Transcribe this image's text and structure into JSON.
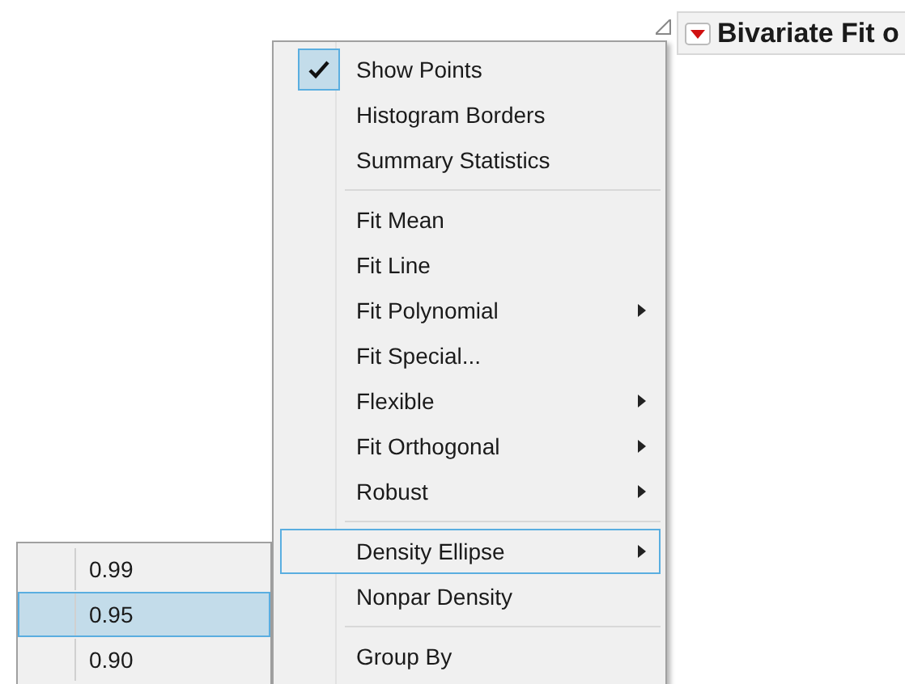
{
  "report_header": {
    "title": "Bivariate Fit o"
  },
  "menu": {
    "sections": [
      {
        "items": [
          {
            "label": "Show Points",
            "checked": true,
            "has_submenu": false,
            "selected": false
          },
          {
            "label": "Histogram Borders",
            "checked": false,
            "has_submenu": false,
            "selected": false
          },
          {
            "label": "Summary Statistics",
            "checked": false,
            "has_submenu": false,
            "selected": false
          }
        ]
      },
      {
        "items": [
          {
            "label": "Fit Mean",
            "checked": false,
            "has_submenu": false,
            "selected": false
          },
          {
            "label": "Fit Line",
            "checked": false,
            "has_submenu": false,
            "selected": false
          },
          {
            "label": "Fit Polynomial",
            "checked": false,
            "has_submenu": true,
            "selected": false
          },
          {
            "label": "Fit Special...",
            "checked": false,
            "has_submenu": false,
            "selected": false
          },
          {
            "label": "Flexible",
            "checked": false,
            "has_submenu": true,
            "selected": false
          },
          {
            "label": "Fit Orthogonal",
            "checked": false,
            "has_submenu": true,
            "selected": false
          },
          {
            "label": "Robust",
            "checked": false,
            "has_submenu": true,
            "selected": false
          }
        ]
      },
      {
        "items": [
          {
            "label": "Density Ellipse",
            "checked": false,
            "has_submenu": true,
            "selected": true
          },
          {
            "label": "Nonpar Density",
            "checked": false,
            "has_submenu": false,
            "selected": false
          }
        ]
      },
      {
        "items": [
          {
            "label": "Group By",
            "checked": false,
            "has_submenu": false,
            "selected": false
          }
        ]
      }
    ]
  },
  "submenu": {
    "items": [
      {
        "label": "0.99",
        "selected": false
      },
      {
        "label": "0.95",
        "selected": true
      },
      {
        "label": "0.90",
        "selected": false
      }
    ]
  }
}
